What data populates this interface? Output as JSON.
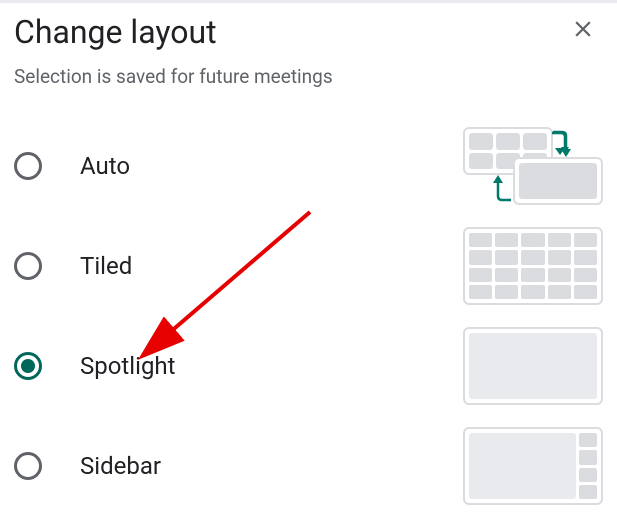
{
  "dialog": {
    "title": "Change layout",
    "subtitle": "Selection is saved for future meetings"
  },
  "options": [
    {
      "id": "auto",
      "label": "Auto",
      "selected": false
    },
    {
      "id": "tiled",
      "label": "Tiled",
      "selected": false
    },
    {
      "id": "spotlight",
      "label": "Spotlight",
      "selected": true
    },
    {
      "id": "sidebar",
      "label": "Sidebar",
      "selected": false
    }
  ],
  "annotation": {
    "type": "arrow",
    "color": "#e60000",
    "target": "spotlight"
  }
}
